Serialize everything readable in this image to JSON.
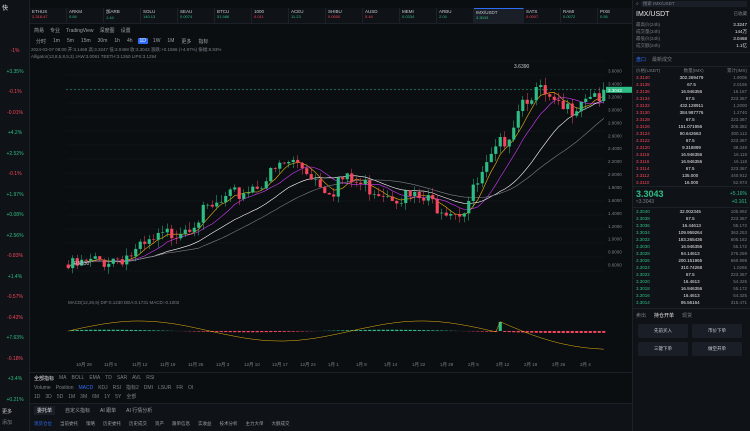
{
  "left_panel": {
    "title": "快",
    "percentages": [
      {
        "v": "-1%",
        "c": "red"
      },
      {
        "v": "+3.35%",
        "c": "grn"
      },
      {
        "v": "-0.1%",
        "c": "red"
      },
      {
        "v": "-0.01%",
        "c": "red"
      },
      {
        "v": "+4.2%",
        "c": "grn"
      },
      {
        "v": "+2.52%",
        "c": "grn"
      },
      {
        "v": "-0.1%",
        "c": "red"
      },
      {
        "v": "+1.97%",
        "c": "grn"
      },
      {
        "v": "+0.08%",
        "c": "grn"
      },
      {
        "v": "+2.56%",
        "c": "grn"
      },
      {
        "v": "-0.83%",
        "c": "red"
      },
      {
        "v": "+1.4%",
        "c": "grn"
      },
      {
        "v": "-0.57%",
        "c": "red"
      },
      {
        "v": "-0.42%",
        "c": "red"
      },
      {
        "v": "+7.63%",
        "c": "grn"
      },
      {
        "v": "-0.18%",
        "c": "red"
      },
      {
        "v": "+3.4%",
        "c": "grn"
      },
      {
        "v": "+0.21%",
        "c": "grn"
      }
    ],
    "bottom_label": "更多",
    "bottom_link": "添加"
  },
  "tabs": [
    {
      "name": "ETHUS",
      "quote": "2,318.47",
      "c": "red"
    },
    {
      "name": "ARKM",
      "quote": "0.84",
      "c": "grn"
    },
    {
      "name": "加ARB",
      "quote": "1.44",
      "c": "grn"
    },
    {
      "name": "SOLU",
      "quote": "140.13",
      "c": "grn"
    },
    {
      "name": "SEAU",
      "quote": "0.0074",
      "c": "grn"
    },
    {
      "name": "BTCU",
      "quote": "51,986",
      "c": "grn"
    },
    {
      "name": "1000",
      "quote": "0.011",
      "c": "red"
    },
    {
      "name": "ACEU",
      "quote": "11.23",
      "c": "grn"
    },
    {
      "name": "SHIBU",
      "quote": "0.0000",
      "c": "red"
    },
    {
      "name": "AUSD",
      "quote": "5.44",
      "c": "red"
    },
    {
      "name": "MEMI",
      "quote": "0.0334",
      "c": "grn"
    },
    {
      "name": "ARBU",
      "quote": "2.04",
      "c": "grn"
    },
    {
      "name": "IMX/USDT",
      "quote": "3.3043",
      "c": "grn",
      "active": true
    },
    {
      "name": "SATS",
      "quote": "0.0007",
      "c": "red"
    },
    {
      "name": "RAMI",
      "quote": "0.0072",
      "c": "grn"
    },
    {
      "name": "PIXE",
      "quote": "0.55",
      "c": "grn"
    },
    {
      "name": "SPTU",
      "quote": "1.53",
      "c": "grn"
    },
    {
      "name": "MANT",
      "quote": "0.87",
      "c": "grn"
    },
    {
      "name": "METIS",
      "quote": "92.10",
      "c": "red"
    },
    {
      "name": "STRK",
      "quote": "1.96",
      "c": "red"
    }
  ],
  "menu": [
    "简易",
    "专业",
    "TradingView",
    "深度图",
    "设置"
  ],
  "toolbar": [
    "分时",
    "1m",
    "5m",
    "15m",
    "30m",
    "1h",
    "4h",
    "1D",
    "1W",
    "1M",
    "更多",
    "指标"
  ],
  "toolbar_active": "1D",
  "info_line1": "2024-03-07 08:00  开:3.1468  高:3.3247  低:3.0468  收:3.3043  涨跌:+0.1566 (+4.97%)  振幅:8.83%",
  "info_line2": "Alligator(13,8,5,8,5,3)  JAW:3.0091  TEETH:3.1260  LIPS:3.1294",
  "macd_label": "MACD(12,26,9)  DIF:0.1230  DEA:0.1731  MACD:-0.1002",
  "high_label": "3.6390",
  "low_label": "0.5530",
  "chart_data": {
    "type": "candlestick",
    "x_labels": [
      "10月 29",
      "11月 5",
      "11月 12",
      "11月 19",
      "11月 26",
      "12月 3",
      "12月 10",
      "12月 17",
      "12月 24",
      "1月 1",
      "1月 8",
      "1月 14",
      "1月 22",
      "1月 29",
      "2月 5",
      "2月 12",
      "2月 19",
      "2月 26",
      "3月 4"
    ],
    "y_ticks": [
      3.6,
      3.4,
      3.2,
      3.0,
      2.8,
      2.6,
      2.4,
      2.2,
      2.0,
      1.8,
      1.6,
      1.4,
      1.2,
      1.0,
      0.8,
      0.6
    ],
    "current_price": "3.3043"
  },
  "indicators": {
    "tabs": [
      "全部指标",
      "MA",
      "BOLL",
      "EMA",
      "TD",
      "SAR",
      "AVL",
      "RSI"
    ],
    "sub": [
      "Volume",
      "Position",
      "MACD",
      "KDJ",
      "RSI",
      "指标2",
      "DMI",
      "LSUR",
      "FR",
      "OI"
    ],
    "timerow": [
      "1D",
      "3D",
      "5D",
      "1M",
      "3M",
      "6M",
      "1Y",
      "5Y",
      "全部"
    ]
  },
  "bottom_tabs": [
    "委托单",
    "自定义指标",
    "AI 跟单",
    "AI 行情分析"
  ],
  "bottom_sub": [
    "现货仓位",
    "当前委托",
    "策略",
    "历史委托",
    "历史成交",
    "资产",
    "跟单信息",
    "实收益",
    "技术分析",
    "主力大单",
    "大额成交"
  ],
  "rightpanel": {
    "search_placeholder": "搜索 IMX/USDT",
    "pair": "IMX/USDT",
    "pair_status": "已收藏",
    "stats": [
      {
        "k": "最高价(24h)",
        "v": "3.3247"
      },
      {
        "k": "成交量(24h)",
        "v": "144万"
      },
      {
        "k": "最低价(24h)",
        "v": "3.0468"
      },
      {
        "k": "成交额(24h)",
        "v": "1.1亿"
      }
    ],
    "side_vals": [
      "11.325",
      "11.142"
    ],
    "tabs": [
      "盘口",
      "最新成交"
    ],
    "depth_header": [
      "价格(USDT)",
      "数量(IMX)",
      "累计(IMX)"
    ],
    "asks": [
      [
        "3.3140",
        "302.269479",
        "1.9006"
      ],
      [
        "3.3138",
        "67.5",
        "2.0156"
      ],
      [
        "3.3136",
        "16.946356",
        "16.187"
      ],
      [
        "3.3134",
        "67.5",
        "223.367"
      ],
      [
        "3.3132",
        "432.128911",
        "1.2000"
      ],
      [
        "3.3130",
        "384.987776",
        "1.2740"
      ],
      [
        "3.3128",
        "67.5",
        "223.367"
      ],
      [
        "3.3126",
        "151.071956",
        "305.382"
      ],
      [
        "3.3124",
        "90.642663",
        "300.112"
      ],
      [
        "3.3122",
        "67.5",
        "223.367"
      ],
      [
        "3.3120",
        "9.318899",
        "38.349"
      ],
      [
        "3.3118",
        "16.946356",
        "16.118"
      ],
      [
        "3.3116",
        "16.946356",
        "16.118"
      ],
      [
        "3.3114",
        "67.5",
        "223.367"
      ],
      [
        "3.3112",
        "135.000",
        "440.912"
      ],
      [
        "3.3110",
        "16.000",
        "52.973"
      ]
    ],
    "mid_price": "3.3043",
    "mid_change": "+5.16%",
    "mid_sub": "≈3.3043",
    "mid_val": "+0.161",
    "bids": [
      [
        "3.3040",
        "32.002345",
        "105.992"
      ],
      [
        "3.3038",
        "67.5",
        "223.367"
      ],
      [
        "3.3036",
        "16.44613",
        "55.172"
      ],
      [
        "3.3034",
        "109.959264",
        "363.253"
      ],
      [
        "3.3032",
        "183.265436",
        "605.182"
      ],
      [
        "3.3030",
        "16.946356",
        "55.172"
      ],
      [
        "3.3028",
        "94.14613",
        "275.259"
      ],
      [
        "3.3026",
        "200.151965",
        "660.998"
      ],
      [
        "3.3024",
        "310.74268",
        "1.0266"
      ],
      [
        "3.3022",
        "67.5",
        "223.367"
      ],
      [
        "3.3020",
        "16.4613",
        "54.325"
      ],
      [
        "3.3018",
        "16.946356",
        "55.172"
      ],
      [
        "3.3016",
        "16.4613",
        "54.325"
      ],
      [
        "3.3014",
        "95.56164",
        "315.471"
      ]
    ],
    "order_tabs": [
      "卖出",
      "持仓开单",
      "现货"
    ],
    "order_btns": [
      "先前买入",
      "市价下单",
      "三键下单",
      "做空开单"
    ]
  }
}
